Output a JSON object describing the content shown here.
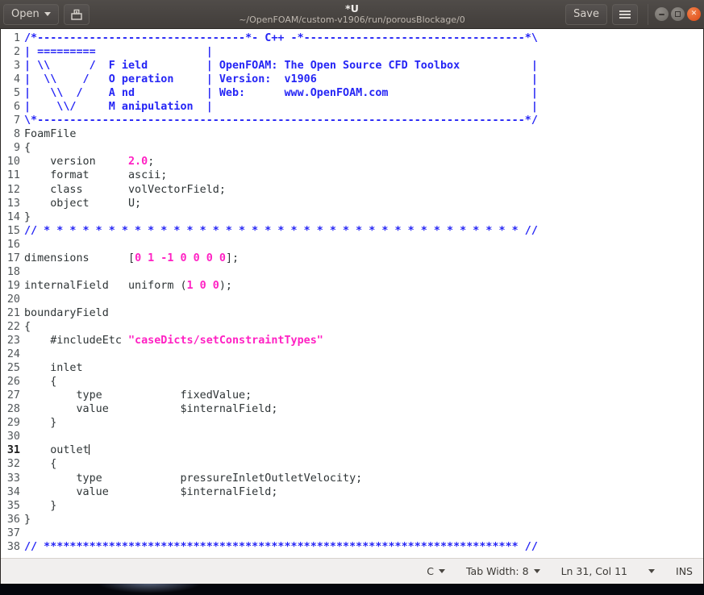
{
  "titlebar": {
    "open_label": "Open",
    "open_icon": "chevron-down-icon",
    "save_doc_icon": "save-document-icon",
    "title": "*U",
    "subtitle": "~/OpenFOAM/custom-v1906/run/porousBlockage/0",
    "save_label": "Save",
    "menu_icon": "hamburger-menu-icon",
    "minimize_icon": "minimize-icon",
    "maximize_icon": "maximize-icon",
    "close_icon": "close-icon",
    "accent_close": "#dd4814",
    "bar_bg": "#474340"
  },
  "editor": {
    "colors": {
      "background": "#ffffff",
      "text": "#2e3436",
      "comment": "#2525f5",
      "string": "#ff21c3",
      "number": "#ff21c3",
      "line_number": "#52575a"
    },
    "current_line": 31,
    "cursor_line_text": "    outlet",
    "lines": [
      {
        "n": 1,
        "segments": [
          {
            "t": "/*--------------------------------*- C++ -*----------------------------------*\\",
            "c": "cmt"
          }
        ]
      },
      {
        "n": 2,
        "segments": [
          {
            "t": "| =========                 |",
            "c": "cmt"
          }
        ]
      },
      {
        "n": 3,
        "segments": [
          {
            "t": "| \\\\      /  F ield         | OpenFOAM: The Open Source CFD Toolbox           |",
            "c": "cmt"
          }
        ]
      },
      {
        "n": 4,
        "segments": [
          {
            "t": "|  \\\\    /   O peration     | Version:  v1906                                 |",
            "c": "cmt"
          }
        ]
      },
      {
        "n": 5,
        "segments": [
          {
            "t": "|   \\\\  /    A nd           | Web:      www.OpenFOAM.com                      |",
            "c": "cmt"
          }
        ]
      },
      {
        "n": 6,
        "segments": [
          {
            "t": "|    \\\\/     M anipulation  |                                                 |",
            "c": "cmt"
          }
        ]
      },
      {
        "n": 7,
        "segments": [
          {
            "t": "\\*---------------------------------------------------------------------------*/",
            "c": "cmt"
          }
        ]
      },
      {
        "n": 8,
        "segments": [
          {
            "t": "FoamFile",
            "c": "plain"
          }
        ]
      },
      {
        "n": 9,
        "segments": [
          {
            "t": "{",
            "c": "plain"
          }
        ]
      },
      {
        "n": 10,
        "segments": [
          {
            "t": "    version     ",
            "c": "plain"
          },
          {
            "t": "2.0",
            "c": "num"
          },
          {
            "t": ";",
            "c": "plain"
          }
        ]
      },
      {
        "n": 11,
        "segments": [
          {
            "t": "    format      ascii;",
            "c": "plain"
          }
        ]
      },
      {
        "n": 12,
        "segments": [
          {
            "t": "    class       volVectorField;",
            "c": "plain"
          }
        ]
      },
      {
        "n": 13,
        "segments": [
          {
            "t": "    object      U;",
            "c": "plain"
          }
        ]
      },
      {
        "n": 14,
        "segments": [
          {
            "t": "}",
            "c": "plain"
          }
        ]
      },
      {
        "n": 15,
        "segments": [
          {
            "t": "// * * * * * * * * * * * * * * * * * * * * * * * * * * * * * * * * * * * * * //",
            "c": "cmt"
          }
        ]
      },
      {
        "n": 16,
        "segments": [
          {
            "t": "",
            "c": "plain"
          }
        ]
      },
      {
        "n": 17,
        "segments": [
          {
            "t": "dimensions      [",
            "c": "plain"
          },
          {
            "t": "0 1 -1 0 0 0 0",
            "c": "num"
          },
          {
            "t": "];",
            "c": "plain"
          }
        ]
      },
      {
        "n": 18,
        "segments": [
          {
            "t": "",
            "c": "plain"
          }
        ]
      },
      {
        "n": 19,
        "segments": [
          {
            "t": "internalField   uniform (",
            "c": "plain"
          },
          {
            "t": "1 0 0",
            "c": "num"
          },
          {
            "t": ");",
            "c": "plain"
          }
        ]
      },
      {
        "n": 20,
        "segments": [
          {
            "t": "",
            "c": "plain"
          }
        ]
      },
      {
        "n": 21,
        "segments": [
          {
            "t": "boundaryField",
            "c": "plain"
          }
        ]
      },
      {
        "n": 22,
        "segments": [
          {
            "t": "{",
            "c": "plain"
          }
        ]
      },
      {
        "n": 23,
        "segments": [
          {
            "t": "    #includeEtc ",
            "c": "plain"
          },
          {
            "t": "\"caseDicts/setConstraintTypes\"",
            "c": "str"
          }
        ]
      },
      {
        "n": 24,
        "segments": [
          {
            "t": "",
            "c": "plain"
          }
        ]
      },
      {
        "n": 25,
        "segments": [
          {
            "t": "    inlet",
            "c": "plain"
          }
        ]
      },
      {
        "n": 26,
        "segments": [
          {
            "t": "    {",
            "c": "plain"
          }
        ]
      },
      {
        "n": 27,
        "segments": [
          {
            "t": "        type            fixedValue;",
            "c": "plain"
          }
        ]
      },
      {
        "n": 28,
        "segments": [
          {
            "t": "        value           $internalField;",
            "c": "plain"
          }
        ]
      },
      {
        "n": 29,
        "segments": [
          {
            "t": "    }",
            "c": "plain"
          }
        ]
      },
      {
        "n": 30,
        "segments": [
          {
            "t": "",
            "c": "plain"
          }
        ]
      },
      {
        "n": 31,
        "segments": [
          {
            "t": "    outlet",
            "c": "plain"
          }
        ],
        "cursor": true
      },
      {
        "n": 32,
        "segments": [
          {
            "t": "    {",
            "c": "plain"
          }
        ]
      },
      {
        "n": 33,
        "segments": [
          {
            "t": "        type            pressureInletOutletVelocity;",
            "c": "plain"
          }
        ]
      },
      {
        "n": 34,
        "segments": [
          {
            "t": "        value           $internalField;",
            "c": "plain"
          }
        ]
      },
      {
        "n": 35,
        "segments": [
          {
            "t": "    }",
            "c": "plain"
          }
        ]
      },
      {
        "n": 36,
        "segments": [
          {
            "t": "}",
            "c": "plain"
          }
        ]
      },
      {
        "n": 37,
        "segments": [
          {
            "t": "",
            "c": "plain"
          }
        ]
      },
      {
        "n": 38,
        "segments": [
          {
            "t": "// ************************************************************************* //",
            "c": "cmt"
          }
        ]
      }
    ]
  },
  "statusbar": {
    "language": "C",
    "tab_width": "Tab Width: 8",
    "position": "Ln 31, Col 11",
    "insert_mode": "INS"
  }
}
